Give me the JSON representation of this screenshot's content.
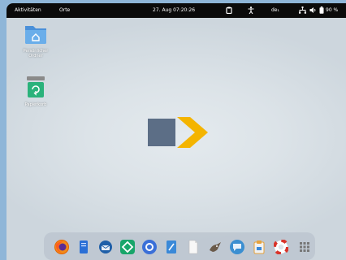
{
  "topbar": {
    "activities": "Aktivitäten",
    "places": "Orte",
    "datetime": "27. Aug  07:20:26",
    "keyboard": "de₁",
    "battery": "90 %"
  },
  "desktop": {
    "icons": [
      {
        "label": "Persönlicher Ordner",
        "icon": "home-folder-icon"
      },
      {
        "label": "Papierkorb",
        "icon": "trash-icon"
      }
    ]
  },
  "dock": {
    "apps": [
      {
        "name": "firefox",
        "color": "#e66000"
      },
      {
        "name": "notes",
        "color": "#2a6fd6"
      },
      {
        "name": "thunderbird",
        "color": "#1f5fa8"
      },
      {
        "name": "software",
        "color": "#18a56a"
      },
      {
        "name": "disks",
        "color": "#3a6fd8"
      },
      {
        "name": "editor",
        "color": "#3a89d8"
      },
      {
        "name": "documents",
        "color": "#f0f0f0"
      },
      {
        "name": "gimp",
        "color": "#6a5a4a"
      },
      {
        "name": "chat",
        "color": "#3b8fd1"
      },
      {
        "name": "clipboard",
        "color": "#e6a23c"
      },
      {
        "name": "help",
        "color": "#d9342b"
      },
      {
        "name": "app-grid",
        "color": "#777777"
      }
    ]
  }
}
